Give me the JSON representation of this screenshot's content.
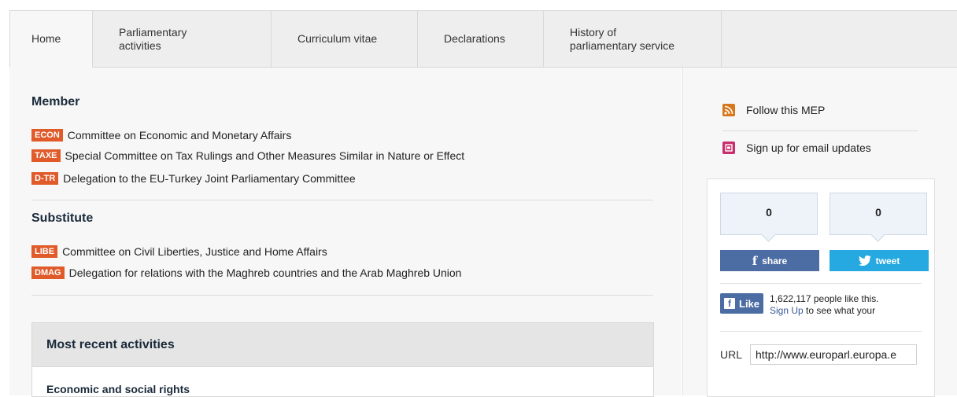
{
  "tabs": [
    {
      "line1": "Home",
      "line2": ""
    },
    {
      "line1": "Parliamentary",
      "line2": "activities"
    },
    {
      "line1": "Curriculum vitae",
      "line2": ""
    },
    {
      "line1": "Declarations",
      "line2": ""
    },
    {
      "line1": "History of",
      "line2": "parliamentary service"
    }
  ],
  "member": {
    "title": "Member",
    "items": [
      {
        "code": "ECON",
        "name": "Committee on Economic and Monetary Affairs"
      },
      {
        "code": "TAXE",
        "name": "Special Committee on Tax Rulings and Other Measures Similar in Nature or Effect"
      },
      {
        "code": "D-TR",
        "name": "Delegation to the EU-Turkey Joint Parliamentary Committee"
      }
    ]
  },
  "substitute": {
    "title": "Substitute",
    "items": [
      {
        "code": "LIBE",
        "name": "Committee on Civil Liberties, Justice and Home Affairs"
      },
      {
        "code": "DMAG",
        "name": "Delegation for relations with the Maghreb countries and the Arab Maghreb Union"
      }
    ]
  },
  "activities": {
    "title": "Most recent activities",
    "first_item": "Economic and social rights"
  },
  "sidebar": {
    "follow_label": "Follow this MEP",
    "email_label": "Sign up for email updates",
    "facebook_count": "0",
    "twitter_count": "0",
    "share_label": "share",
    "tweet_label": "tweet",
    "like_label": "Like",
    "like_line1": "1,622,117 people like this.",
    "like_signup": "Sign Up",
    "like_line2_rest": " to see what your",
    "url_label": "URL",
    "url_value": "http://www.europarl.europa.e"
  },
  "colors": {
    "badge": "#e05a2a",
    "facebook": "#4c6ca4",
    "twitter": "#25a9e0",
    "rss": "#d8771b",
    "email": "#c72f6e"
  },
  "icons": [
    "rss-icon",
    "email-icon",
    "facebook-f-icon",
    "twitter-bird-icon"
  ]
}
